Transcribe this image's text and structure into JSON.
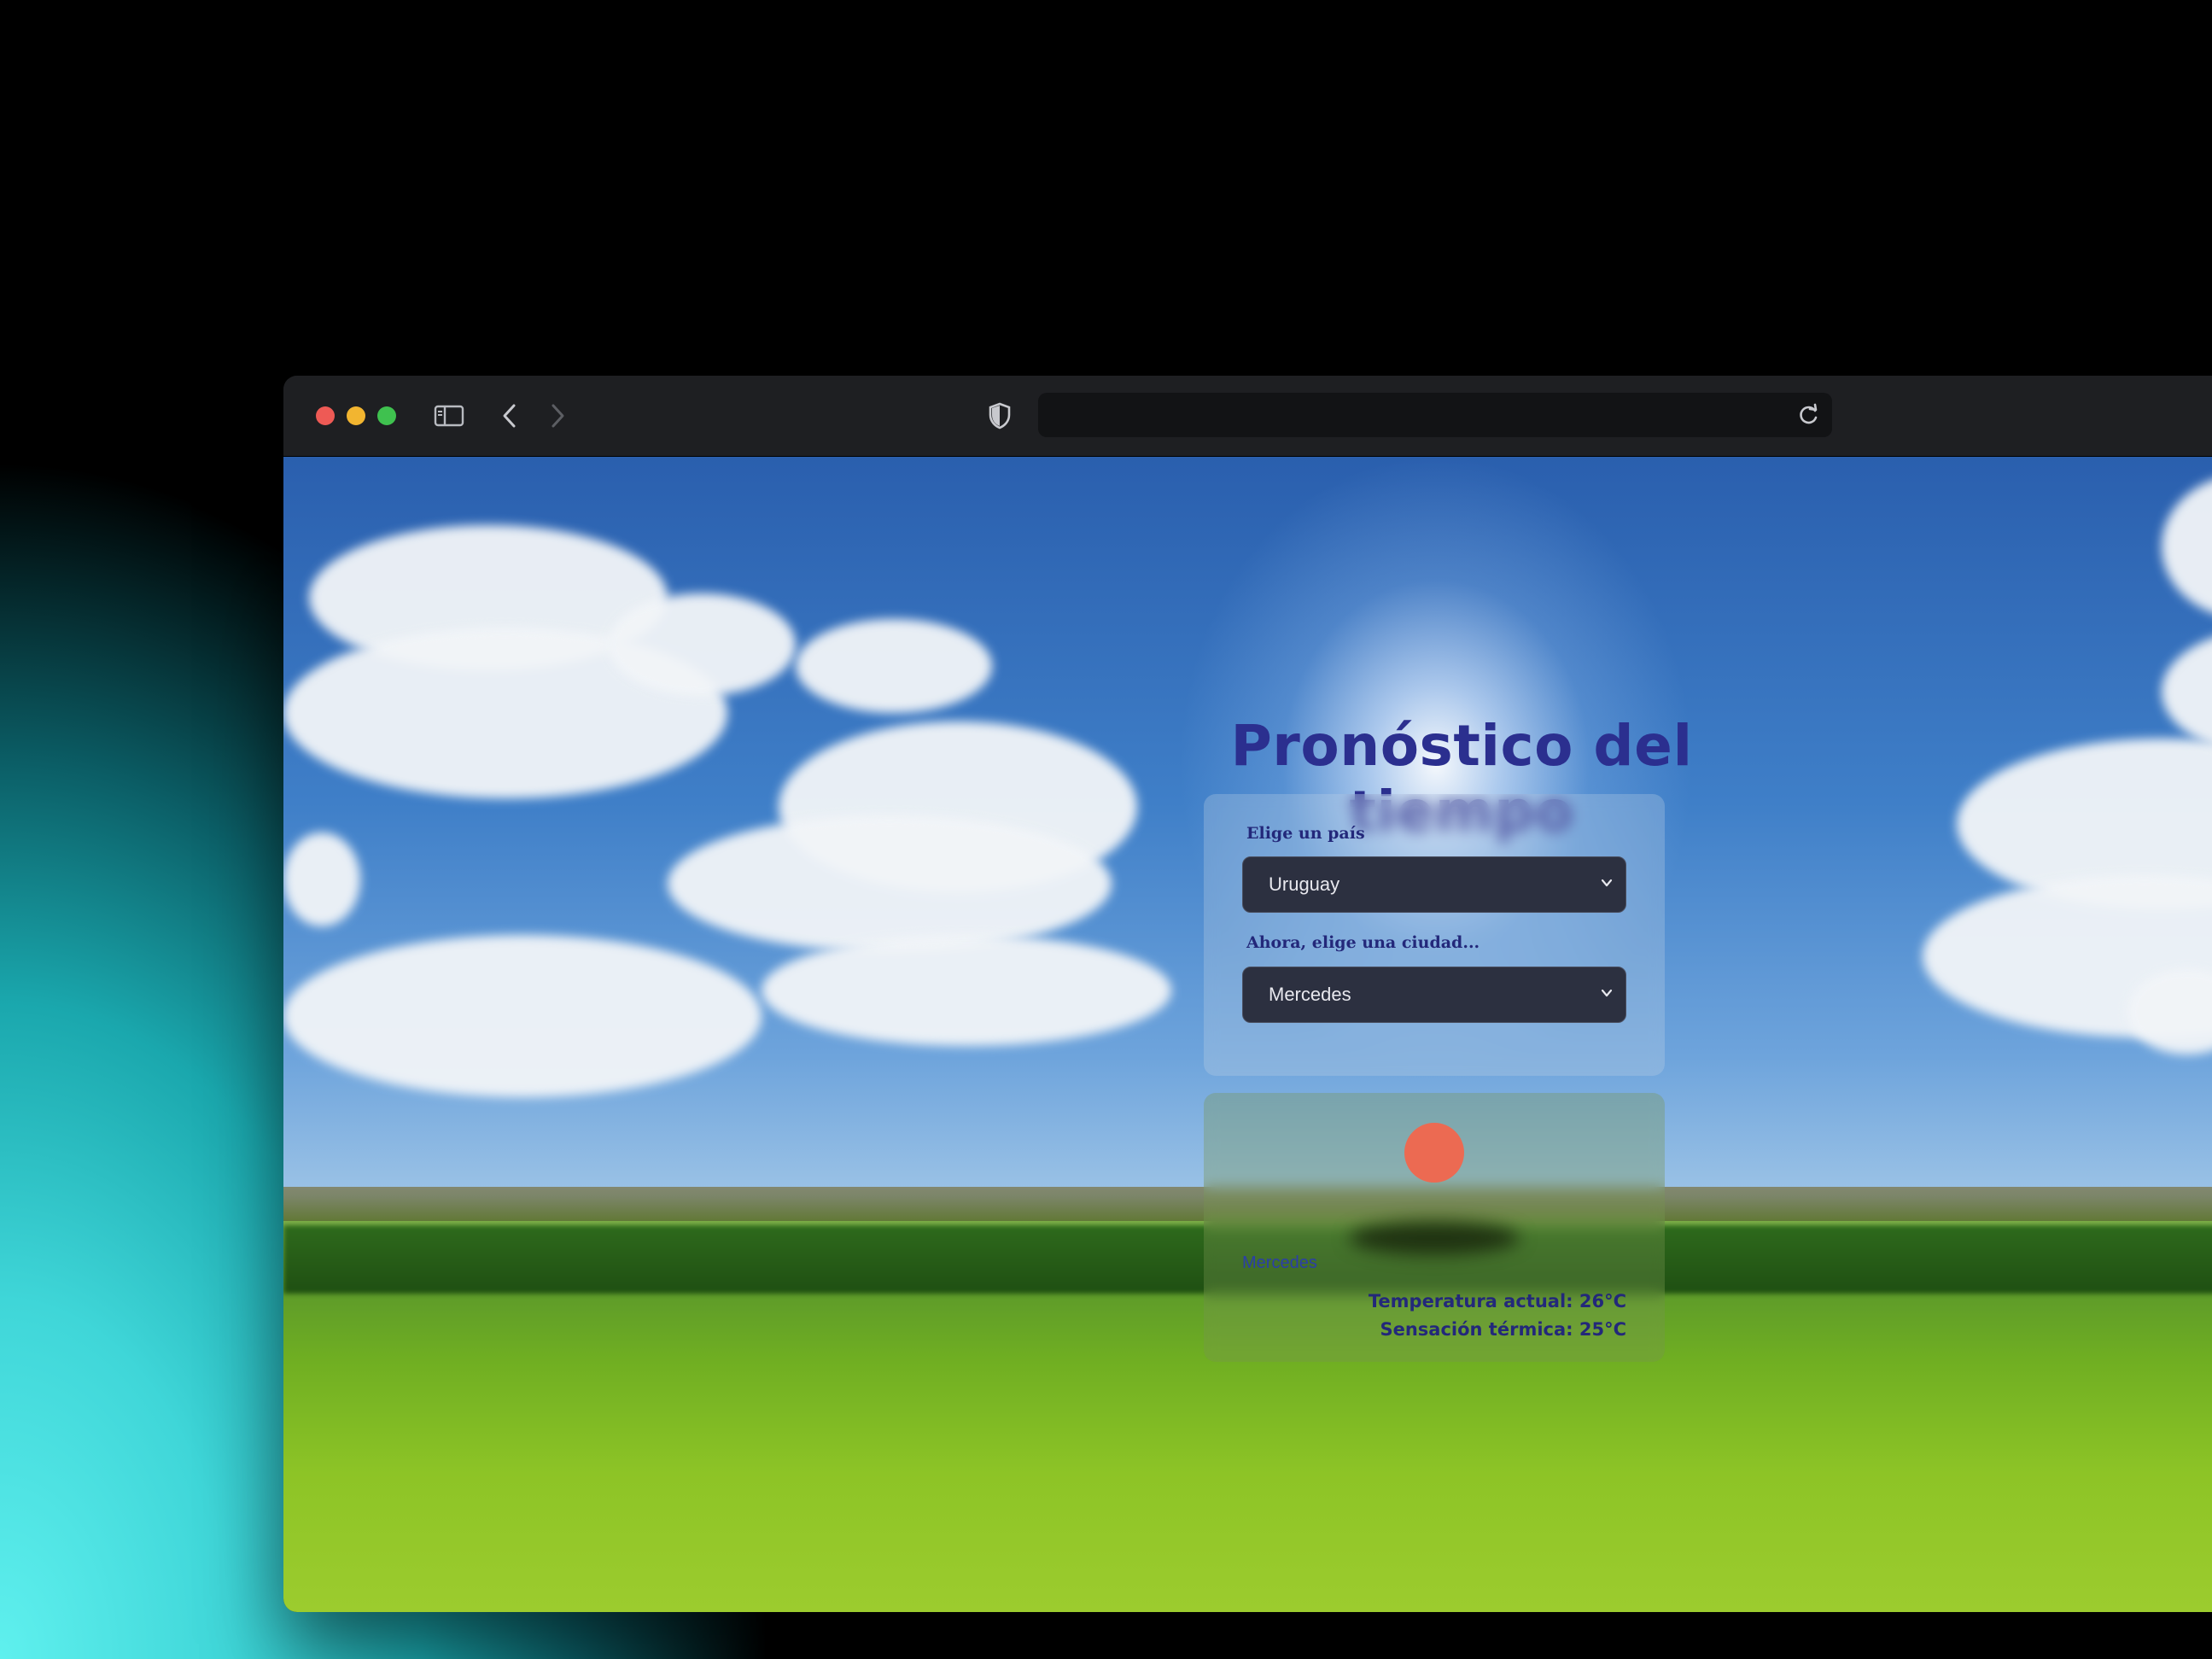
{
  "app": {
    "title": "Pronóstico del tiempo"
  },
  "selectors": {
    "country_label": "Elige un país",
    "country_value": "Uruguay",
    "city_label": "Ahora, elige una ciudad...",
    "city_value": "Mercedes"
  },
  "weather": {
    "city": "Mercedes",
    "current_temp": "Temperatura actual: 26°C",
    "feels_like": "Sensación térmica: 25°C",
    "icon": "sun-icon",
    "icon_color": "#ec6a52"
  },
  "browser": {
    "url": ""
  },
  "colors": {
    "title": "#2b2f8f",
    "select_bg": "#2c3040",
    "traffic_red": "#ee5a55",
    "traffic_yellow": "#f2b530",
    "traffic_green": "#3fc14f"
  }
}
